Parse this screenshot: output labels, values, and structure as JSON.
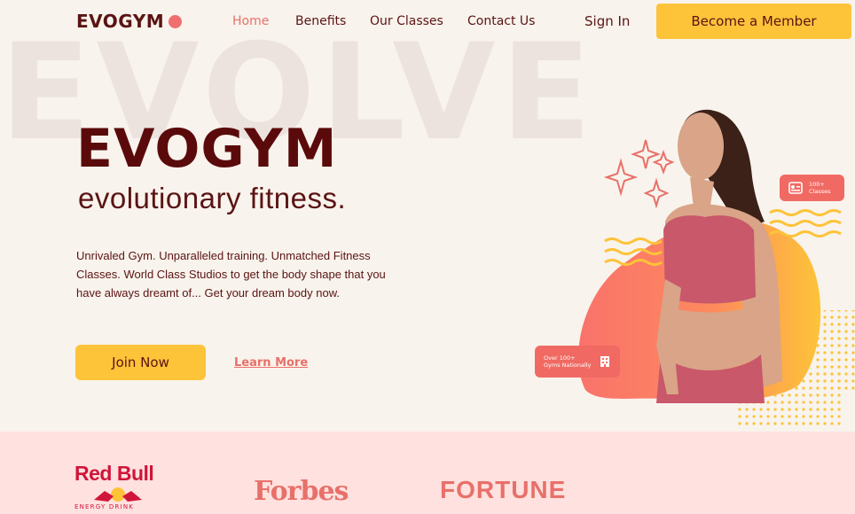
{
  "nav": {
    "logo": "EVOGYM",
    "links": [
      "Home",
      "Benefits",
      "Our Classes",
      "Contact Us"
    ],
    "active": "Home",
    "sign_in": "Sign In",
    "cta": "Become a Member"
  },
  "hero": {
    "watermark": "EVOLVE",
    "title": "EVOGYM",
    "subtitle": "evolutionary fitness.",
    "body": "Unrivaled Gym. Unparalleled training. Unmatched Fitness Classes. World Class Studios to get the body shape that you have always dreamt of... Get your dream body now.",
    "join_label": "Join Now",
    "learn_label": "Learn More"
  },
  "badges": {
    "classes_line1": "100+",
    "classes_line2": "Classes",
    "gyms_line1": "Over 100+",
    "gyms_line2": "Gyms Nationally"
  },
  "sponsors": {
    "redbull": "Red Bull",
    "redbull_sub": "ENERGY DRINK",
    "forbes": "Forbes",
    "fortune": "FORTUNE"
  },
  "colors": {
    "background": "#f8f3ec",
    "primary_dark": "#5a1414",
    "accent_coral": "#e8706a",
    "accent_yellow": "#fdc339",
    "sponsor_band": "#ffe1df"
  },
  "icons": [
    "logo-dot-icon",
    "id-card-icon",
    "building-icon",
    "sparkle-icon"
  ]
}
